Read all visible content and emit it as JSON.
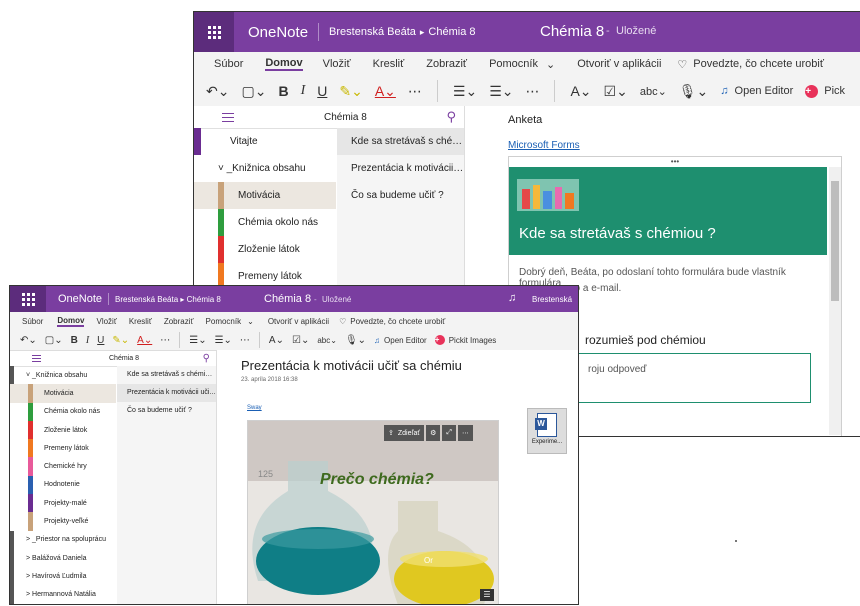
{
  "colors": {
    "accent": "#7a3ea0",
    "teal": "#1e8f6f",
    "pickit": "#e8325a"
  },
  "back": {
    "app_name": "OneNote",
    "breadcrumb_author": "Brestenská Beáta",
    "breadcrumb_notebook": "Chémia 8",
    "doc_title": "Chémia 8",
    "doc_dash": "-",
    "save_status": "Uložené",
    "menu": [
      "Súbor",
      "Domov",
      "Vložiť",
      "Kresliť",
      "Zobraziť",
      "Pomocník",
      "Otvoriť v aplikácii",
      "Povedzte, čo chcete urobiť"
    ],
    "menu_chevron": "⌄",
    "toolbar": {
      "bold": "B",
      "italic": "I",
      "underline": "U",
      "open_editor": "Open Editor",
      "pickit": "Pick"
    },
    "notebook_title": "Chémia 8",
    "sections": [
      {
        "label": "Vitajte",
        "color": "#6a2c91"
      },
      {
        "label": "˅ _Knižnica obsahu",
        "color": "#ffffff"
      },
      {
        "label": "Motivácia",
        "color": "#c8a27a"
      },
      {
        "label": "Chémia okolo nás",
        "color": "#2e9d3e"
      },
      {
        "label": "Zloženie látok",
        "color": "#e0302e"
      },
      {
        "label": "Premeny látok",
        "color": "#f07820"
      }
    ],
    "pages": [
      "Kde sa stretávaš s chémiou ?",
      "Prezentácia k motivácii uči...",
      "Čo sa budeme učiť ?"
    ],
    "anketa": "Anketa",
    "forms_link": "Microsoft Forms",
    "ellipsis": "•••",
    "form_title": "Kde sa stretávaš s chémiou ?",
    "form_text": "Dobrý deň, Beáta, po odoslaní tohto formulára bude vlastník formulára",
    "form_text2": "no a e-mail.",
    "form_question": "rozumieš pod chémiou",
    "form_answer_placeholder": "roju odpoveď"
  },
  "front": {
    "app_name": "OneNote",
    "breadcrumb": "Brestenská Beáta ▸ Chémia 8",
    "doc_title": "Chémia 8",
    "doc_dash": "-",
    "save_status": "Uložené",
    "user_short": "Brestenská",
    "menu": [
      "Súbor",
      "Domov",
      "Vložiť",
      "Kresliť",
      "Zobraziť",
      "Pomocník",
      "Otvoriť v aplikácii",
      "Povedzte, čo chcete urobiť"
    ],
    "menu_chevron": "⌄",
    "toolbar": {
      "bold": "B",
      "italic": "I",
      "underline": "U",
      "open_editor": "Open Editor",
      "pickit": "Pickit Images"
    },
    "notebook_title": "Chémia 8",
    "sections": [
      {
        "label": "˅ _Knižnica obsahu",
        "color": "#ffffff",
        "tab": "#555555"
      },
      {
        "label": "Motivácia",
        "color": "#c8a27a",
        "tab": "#c8a27a",
        "selected": true
      },
      {
        "label": "Chémia okolo nás",
        "color": "#2e9d3e",
        "tab": "#2e9d3e"
      },
      {
        "label": "Zloženie látok",
        "color": "#e0302e",
        "tab": "#e0302e"
      },
      {
        "label": "Premeny látok",
        "color": "#f07820",
        "tab": "#f07820"
      },
      {
        "label": "Chemické hry",
        "color": "#e85a9a",
        "tab": "#e85a9a"
      },
      {
        "label": "Hodnotenie",
        "color": "#2a5fb0",
        "tab": "#2a5fb0"
      },
      {
        "label": "Projekty-malé",
        "color": "#6a2c91",
        "tab": "#6a2c91"
      },
      {
        "label": "Projekty-veľké",
        "color": "#c8a27a",
        "tab": "#c8a27a"
      },
      {
        "label": "> _Priestor na spoluprácu",
        "color": "#ffffff",
        "tab": "#555555"
      },
      {
        "label": "> Balážová Daniela",
        "color": "#ffffff",
        "tab": "#555555"
      },
      {
        "label": "> Havírová Ľudmila",
        "color": "#ffffff",
        "tab": "#555555"
      },
      {
        "label": "> Hermannová Natália",
        "color": "#ffffff",
        "tab": "#555555"
      }
    ],
    "pages": [
      "Kde sa stretávaš s chémiou ?",
      "Prezentácia k motivácii uči...",
      "Čo sa budeme učiť ?"
    ],
    "page_title": "Prezentácia k motivácii učiť sa chémiu",
    "page_date": "23. apríla 2018   16:38",
    "sway_link": "Sway",
    "embed_share": "Zdieľať",
    "embed_ellipsis": "•••",
    "embed_title": "Prečo chémia?",
    "attachment_label": "Experime..."
  }
}
